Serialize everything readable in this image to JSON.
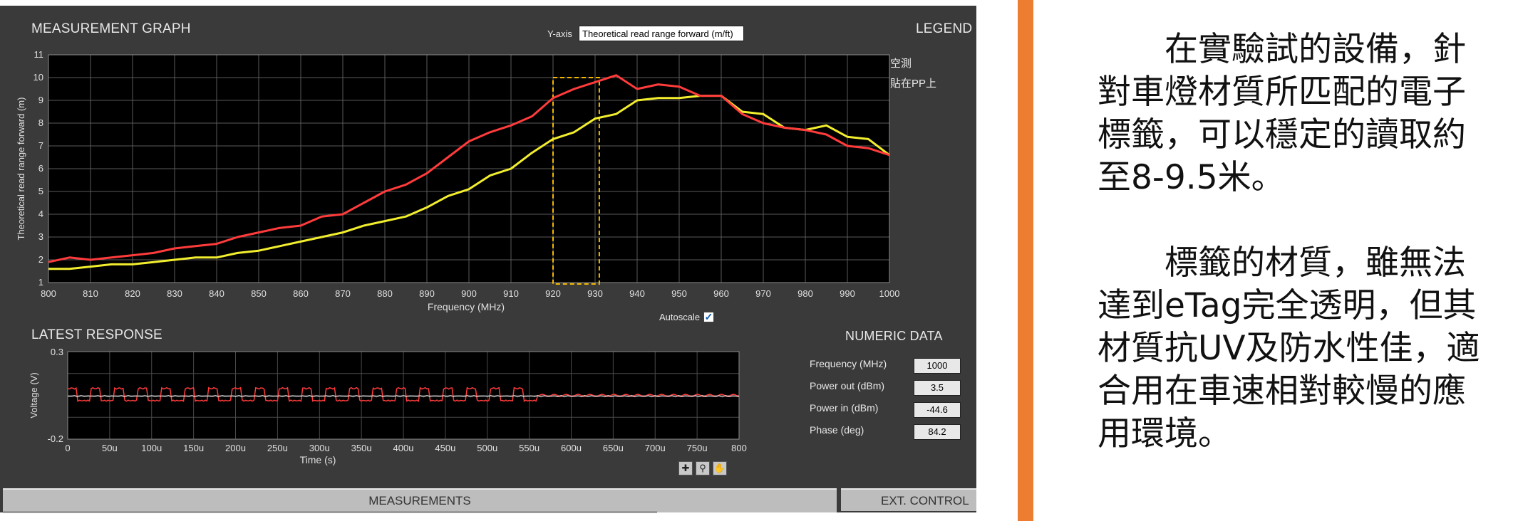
{
  "measurement_graph": {
    "title": "MEASUREMENT GRAPH",
    "legend_title": "LEGEND",
    "yaxis_label": "Y-axis",
    "yaxis_selected": "Theoretical read range forward (m/ft)",
    "autoscale_label": "Autoscale",
    "autoscale_checked": true,
    "legend_entries": [
      "空測",
      "貼在PP上"
    ]
  },
  "latest_response": {
    "title": "LATEST RESPONSE",
    "tools": [
      "zoom-icon",
      "magnify-icon",
      "pan-hand-icon"
    ]
  },
  "numeric_data": {
    "title": "NUMERIC DATA",
    "fields": [
      {
        "label": "Frequency (MHz)",
        "value": "1000"
      },
      {
        "label": "Power out (dBm)",
        "value": "3.5"
      },
      {
        "label": "Power in (dBm)",
        "value": "-44.6"
      },
      {
        "label": "Phase (deg)",
        "value": "84.2"
      }
    ]
  },
  "tabs": {
    "measurements": "MEASUREMENTS",
    "ext_control": "EXT. CONTROL"
  },
  "colors": {
    "background": "#3a3a3a",
    "plot_background": "#000000",
    "series_red": "#ff3b3b",
    "series_yellow": "#f2ee2e",
    "highlight": "#f5b800",
    "accent_bar": "#ed7d31"
  },
  "text": {
    "para1": "在實驗試的設備，針對車燈材質所匹配的電子標籤，可以穩定的讀取約至8-9.5米。",
    "para2": "標籤的材質，雖無法達到eTag完全透明，但其材質抗UV及防水性佳，適合用在車速相對較慢的應用環境。"
  },
  "chart_data": [
    {
      "type": "line",
      "xlabel": "Frequency (MHz)",
      "ylabel": "Theoretical read range forward (m)",
      "xlim": [
        800,
        1000
      ],
      "ylim": [
        1,
        11
      ],
      "xticks": [
        800,
        810,
        820,
        830,
        840,
        850,
        860,
        870,
        880,
        890,
        900,
        910,
        920,
        930,
        940,
        950,
        960,
        970,
        980,
        990,
        1000
      ],
      "yticks": [
        1,
        2,
        3,
        4,
        5,
        6,
        7,
        8,
        9,
        10,
        11
      ],
      "grid": true,
      "highlight_range": [
        920,
        931
      ],
      "x": [
        800,
        805,
        810,
        815,
        820,
        825,
        830,
        835,
        840,
        845,
        850,
        855,
        860,
        865,
        870,
        875,
        880,
        885,
        890,
        895,
        900,
        905,
        910,
        915,
        920,
        925,
        930,
        935,
        940,
        945,
        950,
        955,
        960,
        965,
        970,
        975,
        980,
        985,
        990,
        995,
        1000
      ],
      "series": [
        {
          "name": "空測",
          "color": "#ff3b3b",
          "values": [
            1.9,
            2.1,
            2.0,
            2.1,
            2.2,
            2.3,
            2.5,
            2.6,
            2.7,
            3.0,
            3.2,
            3.4,
            3.5,
            3.9,
            4.0,
            4.5,
            5.0,
            5.3,
            5.8,
            6.5,
            7.2,
            7.6,
            7.9,
            8.3,
            9.1,
            9.5,
            9.8,
            10.1,
            9.5,
            9.7,
            9.6,
            9.2,
            9.2,
            8.4,
            8.0,
            7.8,
            7.7,
            7.5,
            7.0,
            6.9,
            6.6
          ]
        },
        {
          "name": "貼在PP上",
          "color": "#f2ee2e",
          "values": [
            1.6,
            1.6,
            1.7,
            1.8,
            1.8,
            1.9,
            2.0,
            2.1,
            2.1,
            2.3,
            2.4,
            2.6,
            2.8,
            3.0,
            3.2,
            3.5,
            3.7,
            3.9,
            4.3,
            4.8,
            5.1,
            5.7,
            6.0,
            6.7,
            7.3,
            7.6,
            8.2,
            8.4,
            9.0,
            9.1,
            9.1,
            9.2,
            9.2,
            8.5,
            8.4,
            7.8,
            7.7,
            7.9,
            7.4,
            7.3,
            6.6
          ]
        }
      ]
    },
    {
      "type": "line",
      "xlabel": "Time (s)",
      "ylabel": "Voltage (V)",
      "xlim": [
        0,
        800
      ],
      "ylim": [
        -0.2,
        0.3
      ],
      "xtick_labels": [
        "0",
        "50u",
        "100u",
        "150u",
        "200u",
        "250u",
        "300u",
        "350u",
        "400u",
        "450u",
        "500u",
        "550u",
        "600u",
        "650u",
        "700u",
        "750u",
        "800"
      ],
      "ytick_labels": [
        "0.3",
        "-0.2"
      ],
      "grid": true,
      "series": [
        {
          "color": "#ff3b3b",
          "description_pattern": "pulsed",
          "baseline": 0.05,
          "high": 0.09,
          "low": 0.02
        },
        {
          "color": "#ffffff",
          "baseline": 0.045
        }
      ]
    }
  ]
}
